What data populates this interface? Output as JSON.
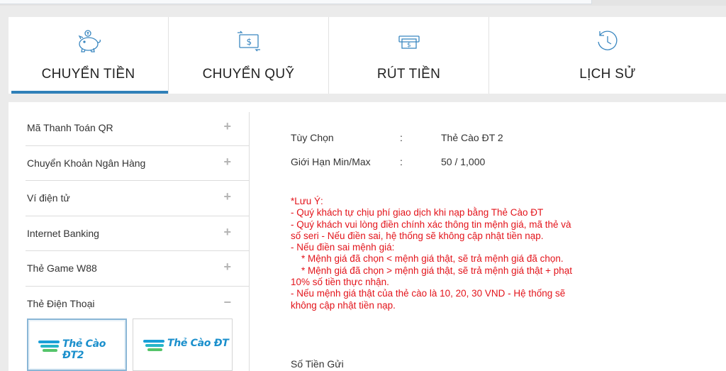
{
  "tabs": [
    {
      "label": "CHUYỂN TIỀN",
      "icon": "piggy-bank-icon",
      "active": true
    },
    {
      "label": "CHUYỂN QUỸ",
      "icon": "money-transfer-icon",
      "active": false
    },
    {
      "label": "RÚT TIỀN",
      "icon": "cash-withdraw-icon",
      "active": false
    },
    {
      "label": "LỊCH SỬ",
      "icon": "history-clock-icon",
      "active": false
    }
  ],
  "sidebar": {
    "items": [
      {
        "label": "Mã Thanh Toán QR",
        "toggle": "+"
      },
      {
        "label": "Chuyển Khoản Ngân Hàng",
        "toggle": "+"
      },
      {
        "label": "Ví điện tử",
        "toggle": "+"
      },
      {
        "label": "Internet Banking",
        "toggle": "+"
      },
      {
        "label": "Thẻ Game W88",
        "toggle": "+"
      },
      {
        "label": "Thẻ Điện Thoại",
        "toggle": "−"
      }
    ],
    "cards": [
      {
        "label": "Thẻ Cào ĐT2",
        "selected": true
      },
      {
        "label": "Thẻ Cào ĐT",
        "selected": false
      }
    ]
  },
  "details": {
    "option_label": "Tùy Chọn",
    "option_value": "Thẻ Cào ĐT 2",
    "limit_label": "Giới Hạn Min/Max",
    "limit_value": "50 / 1,000",
    "separator": ":"
  },
  "note_lines": [
    "*Lưu Ý:",
    "- Quý khách tự chịu phí giao dịch khi nạp bằng Thẻ Cào ĐT",
    "- Quý khách vui lòng điền chính xác thông tin mệnh giá, mã thẻ và số seri - Nếu điền sai, hệ thống sẽ không cập nhật tiền nạp.",
    "- Nếu điền sai mệnh giá:",
    "    * Mệnh giá đã chọn < mệnh giá thật, sẽ trả mệnh giá đã chọn.",
    "    * Mệnh giá đã chọn > mệnh giá thật, sẽ trả mệnh giá thật + phạt 10% số tiền thực nhận.",
    "- Nếu mệnh giá thật của thẻ cào là 10, 20, 30 VND - Hệ thống sẽ không cập nhật tiền nạp."
  ],
  "amount_label": "Số Tiền Gửi",
  "colors": {
    "accent": "#2f80b8",
    "warning": "#e3141b",
    "icon": "#3a87c0"
  }
}
